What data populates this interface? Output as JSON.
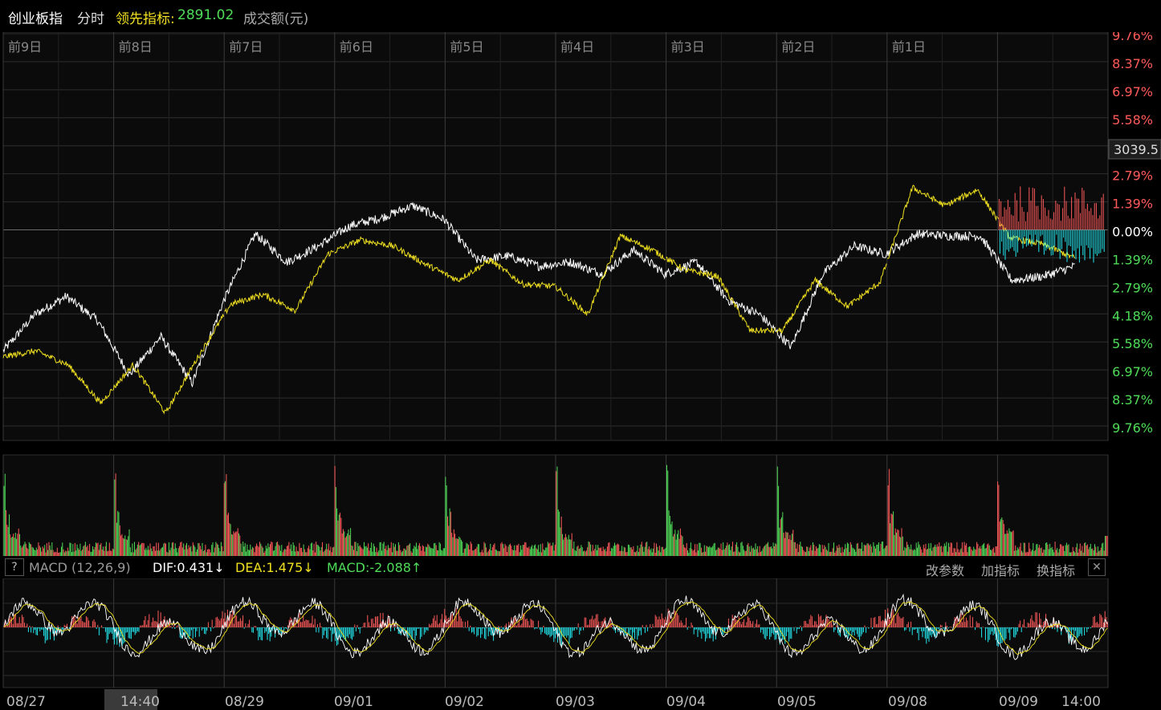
{
  "header": {
    "index_name": "创业板指",
    "mode": "分时",
    "lead_label": "领先指标:",
    "lead_value": "2891.02",
    "volume_label": "成交额(元)"
  },
  "current_price_label": "3039.5",
  "day_labels": [
    "前9日",
    "前8日",
    "前7日",
    "前6日",
    "前5日",
    "前4日",
    "前3日",
    "前2日",
    "前1日"
  ],
  "right_axis": [
    {
      "label": "9.76%",
      "dir": "up"
    },
    {
      "label": "8.37%",
      "dir": "up"
    },
    {
      "label": "6.97%",
      "dir": "up"
    },
    {
      "label": "5.58%",
      "dir": "up"
    },
    {
      "label": "",
      "dir": "up"
    },
    {
      "label": "2.79%",
      "dir": "up"
    },
    {
      "label": "1.39%",
      "dir": "up"
    },
    {
      "label": "0.00%",
      "dir": "flat"
    },
    {
      "label": "1.39%",
      "dir": "down"
    },
    {
      "label": "2.79%",
      "dir": "down"
    },
    {
      "label": "4.18%",
      "dir": "down"
    },
    {
      "label": "5.58%",
      "dir": "down"
    },
    {
      "label": "6.97%",
      "dir": "down"
    },
    {
      "label": "8.37%",
      "dir": "down"
    },
    {
      "label": "9.76%",
      "dir": "down"
    }
  ],
  "macd": {
    "help": "?",
    "title": "MACD (12,26,9)",
    "dif": "DIF:0.431↓",
    "dea": "DEA:1.475↓",
    "macd": "MACD:-2.088↑",
    "buttons": [
      "改参数",
      "加指标",
      "换指标"
    ],
    "close": "✕"
  },
  "date_labels": [
    "08/27",
    "14:40",
    "08/29",
    "09/01",
    "09/02",
    "09/03",
    "09/04",
    "09/05",
    "09/08",
    "09/09",
    "14:00"
  ],
  "colors": {
    "up": "#ff5a5a",
    "down": "#4fdc58",
    "price": "#ffffff",
    "lead": "#f0e020",
    "dea": "#f0e020",
    "dif": "#ffffff",
    "macd_neg": "#22e8f0",
    "grid": "#2e2e2e",
    "highlight_bg": "#3a3a3a"
  },
  "chart_data": {
    "type": "line",
    "title": "创业板指 分时",
    "axis_range_pct": [
      -9.76,
      9.76
    ],
    "series": [
      {
        "name": "price",
        "approx_pct": [
          -6.0,
          -4.2,
          -3.3,
          -4.5,
          -7.2,
          -5.3,
          -7.6,
          -3.5,
          -0.2,
          -1.6,
          -0.8,
          0.2,
          0.6,
          1.2,
          0.5,
          -1.5,
          -1.3,
          -1.8,
          -1.6,
          -2.2,
          -1.0,
          -2.2,
          -1.6,
          -3.5,
          -4.2,
          -5.8,
          -2.2,
          -0.8,
          -1.2,
          -0.2,
          -0.3,
          -0.3,
          -2.5,
          -2.3,
          -1.8
        ]
      },
      {
        "name": "lead",
        "approx_pct": [
          -6.3,
          -6.0,
          -6.7,
          -8.6,
          -6.7,
          -9.1,
          -6.3,
          -3.7,
          -3.2,
          -4.0,
          -1.2,
          -0.5,
          -0.8,
          -1.7,
          -2.5,
          -1.5,
          -2.7,
          -2.8,
          -4.2,
          -0.3,
          -1.0,
          -2.0,
          -2.3,
          -5.0,
          -5.0,
          -2.5,
          -3.8,
          -2.6,
          2.1,
          1.2,
          2.0,
          -0.4,
          -0.7,
          -1.4
        ]
      }
    ]
  }
}
